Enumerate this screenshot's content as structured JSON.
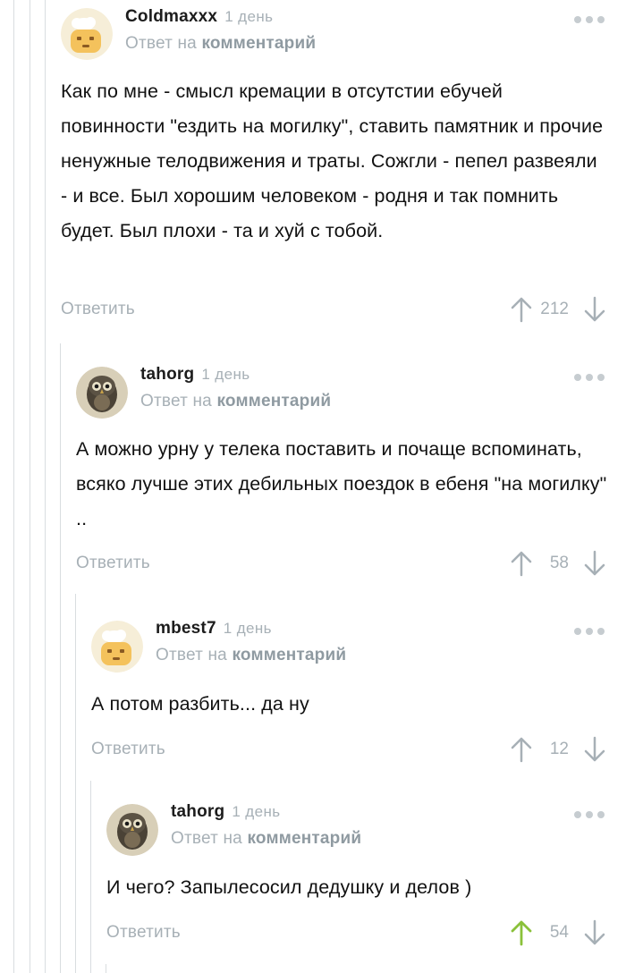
{
  "reply_prefix": "Ответ на",
  "reply_link": "комментарий",
  "reply_button": "Ответить",
  "colors": {
    "muted": "#a7b0b6",
    "upvoted": "#8ac13a",
    "line": "#d9dde0"
  },
  "comments": [
    {
      "author": "Coldmaxxx",
      "date": "1 день",
      "avatar": "default-chef-avatar",
      "text": "Как по мне  - смысл кремации в отсутстии ебучей повинности \"ездить на могилку\", ставить памятник и прочие ненужные телодвижения и траты. Сожгли - пепел развеяли - и все. Был хорошим человеком - родня и так помнить будет. Был плохи - та и хуй с тобой.",
      "rating": "212",
      "upvoted": false
    },
    {
      "author": "tahorg",
      "date": "1 день",
      "avatar": "owl-avatar",
      "text": "А можно урну у телека поставить и почаще вспоминать, всяко лучше этих дебильных поездок в ебеня \"на могилку\" ..",
      "rating": "58",
      "upvoted": false
    },
    {
      "author": "mbest7",
      "date": "1 день",
      "avatar": "default-chef-avatar",
      "text": "А потом разбить... да ну",
      "rating": "12",
      "upvoted": false
    },
    {
      "author": "tahorg",
      "date": "1 день",
      "avatar": "owl-avatar",
      "text": "И чего? Запылесосил дедушку и делов )",
      "rating": "54",
      "upvoted": true
    }
  ]
}
